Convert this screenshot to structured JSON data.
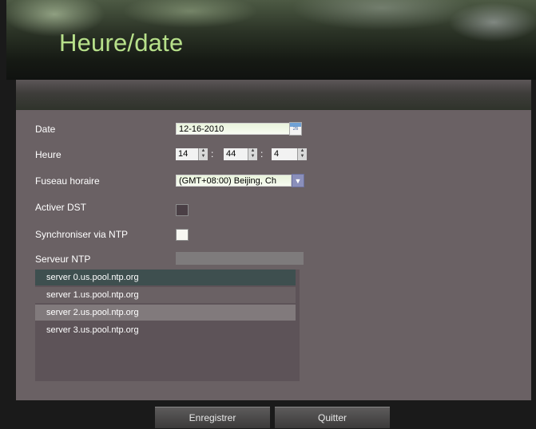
{
  "header": {
    "title": "Heure/date"
  },
  "form": {
    "date_label": "Date",
    "date_value": "12-16-2010",
    "time_label": "Heure",
    "time_hour": "14",
    "time_minute": "44",
    "time_second": "4",
    "time_separator": ":",
    "timezone_label": "Fuseau horaire",
    "timezone_value": "(GMT+08:00) Beijing, Ch",
    "dst_label": "Activer DST",
    "dst_checked": false,
    "ntp_sync_label": "Synchroniser via NTP",
    "ntp_sync_checked": false,
    "ntp_server_label": "Serveur NTP",
    "ntp_server_value": ""
  },
  "ntp_servers": [
    "server 0.us.pool.ntp.org",
    "server 1.us.pool.ntp.org",
    "server 2.us.pool.ntp.org",
    "server 3.us.pool.ntp.org"
  ],
  "buttons": {
    "save": "Enregistrer",
    "quit": "Quitter"
  },
  "icons": {
    "calendar": "calendar-icon",
    "dropdown": "chevron-down-icon",
    "spinner": "spinner-arrows-icon"
  },
  "colors": {
    "title": "#b7e08a",
    "panel": "#6a6164",
    "selected_row": "#3e4f4f"
  }
}
